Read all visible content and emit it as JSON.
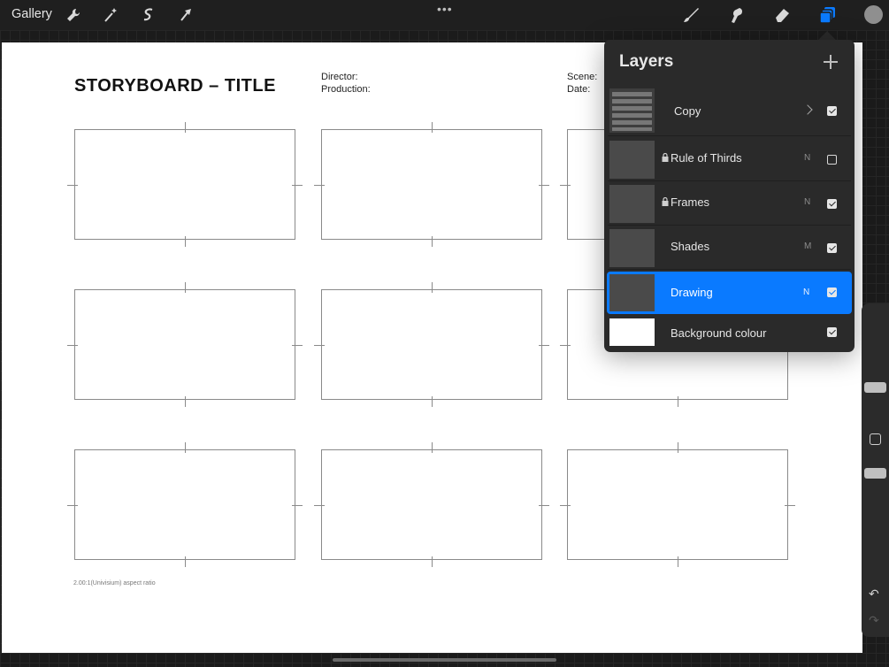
{
  "toolbar": {
    "gallery_label": "Gallery",
    "left_icons": [
      "wrench-icon",
      "magic-wand-icon",
      "selection-icon",
      "transform-arrow-icon"
    ],
    "more_label": "•••",
    "right_icons": [
      "brush-icon",
      "smudge-icon",
      "eraser-icon",
      "layers-icon"
    ],
    "active_color": "#8f8f8f",
    "accent": "#0a7aff"
  },
  "document": {
    "title": "STORYBOARD – TITLE",
    "director_label": "Director:",
    "production_label": "Production:",
    "scene_label": "Scene:",
    "date_label": "Date:",
    "aspect_note": "2.00:1(Univisium) aspect ratio"
  },
  "layers": {
    "title": "Layers",
    "items": [
      {
        "name": "Copy",
        "blend": "",
        "visible": true,
        "locked": false,
        "active": false,
        "group": true
      },
      {
        "name": "Rule of Thirds",
        "blend": "N",
        "visible": false,
        "locked": true,
        "active": false
      },
      {
        "name": "Frames",
        "blend": "N",
        "visible": true,
        "locked": true,
        "active": false
      },
      {
        "name": "Shades",
        "blend": "M",
        "visible": true,
        "locked": false,
        "active": false
      },
      {
        "name": "Drawing",
        "blend": "N",
        "visible": true,
        "locked": false,
        "active": true
      },
      {
        "name": "Background colour",
        "blend": "",
        "visible": true,
        "locked": false,
        "active": false,
        "background": true
      }
    ]
  },
  "sidebar": {
    "undo_label": "↶",
    "redo_label": "↷"
  }
}
